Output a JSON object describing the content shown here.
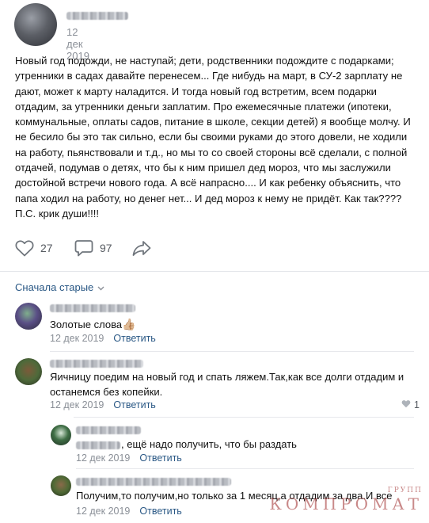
{
  "post": {
    "date": "12 дек 2019",
    "text_lines": [
      "Новый год подожди, не наступай; дети, родственники подождите с подарками;",
      "утренники в садах давайте перенесем... Где нибудь на март, в СУ-2 зарплату не",
      "дают, может к марту наладится. И тогда новый год встретим, всем подарки",
      "отдадим, за утренники деньги заплатим. Про ежемесячные платежи (ипотеки,",
      "коммунальные, оплаты садов, питание в школе, секции детей) я вообще молчу. И",
      "не бесило бы это так сильно, если бы своими руками до этого довели, не ходили",
      "на работу, пьянствовали и т.д., но мы то со своей стороны всё сделали, с полной",
      "отдачей, подумав о детях, что бы к ним пришел дед мороз, что мы заслужили",
      "достойной встречи нового года. А всё напрасно.... И как ребенку объяснить, что",
      "папа ходил на работу, но денег нет... И дед мороз к нему не придёт. Как так????",
      "П.С. крик души!!!!"
    ],
    "likes_count": "27",
    "comments_count": "97",
    "like_icon": "heart-icon",
    "comment_icon": "comment-bubble-icon",
    "share_icon": "share-arrow-icon"
  },
  "comments_sort": {
    "label": "Сначала старые"
  },
  "comments": [
    {
      "text": "Золотые слова",
      "emoji": "👍🏼",
      "date": "12 дек 2019",
      "reply_label": "Ответить"
    },
    {
      "text_lines": [
        "Яичницу поедим на новый год и спать ляжем.Так,как все долги отдадим и",
        "останемся без копейки."
      ],
      "date": "12 дек 2019",
      "reply_label": "Ответить",
      "likes": "1"
    },
    {
      "text": ", ещё надо получить, что бы раздать",
      "date": "12 дек 2019",
      "reply_label": "Ответить"
    },
    {
      "text": "Получим,то получим,но только за 1 месяц,а отдадим за два.И все",
      "date": "12 дек 2019",
      "reply_label": "Ответить"
    }
  ],
  "watermark": {
    "top": "ГРУПП",
    "main": "КОМПРОМАТ"
  },
  "colors": {
    "link": "#2a5885",
    "meta": "#8a8f97",
    "watermark": "#9e2a2a"
  }
}
